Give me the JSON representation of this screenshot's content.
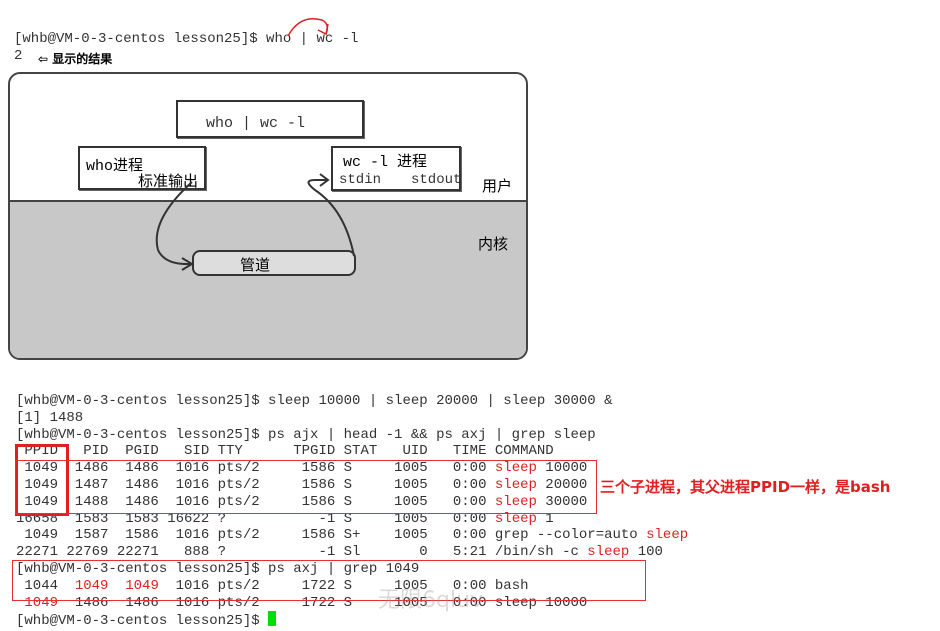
{
  "top_command": {
    "prompt": "[whb@VM-0-3-centos lesson25]$ ",
    "command": "who | wc -l",
    "output": "2",
    "annotation": "显示的结果",
    "arrow_icon": "left-arrow-icon"
  },
  "diagram": {
    "command_box": "who | wc -l",
    "who_process": "who进程",
    "stdout_label": "标准输出",
    "wc_process": "wc -l 进程",
    "stdin": "stdin",
    "stdout": "stdout",
    "user_label": "用户",
    "kernel_label": "内核",
    "pipe_label": "管道",
    "colors": {
      "kernel": "#c8c8c8",
      "arrow": "#e02020"
    }
  },
  "terminal": {
    "lines": [
      [
        {
          "t": "[whb@VM-0-3-centos lesson25]$ sleep 10000 | sleep 20000 | sleep 30000 &"
        }
      ],
      [
        {
          "t": "[1] 1488"
        }
      ],
      [
        {
          "t": "[whb@VM-0-3-centos lesson25]$ ps ajx | head -1 && ps axj | grep sleep"
        }
      ],
      [
        {
          "t": " PPID   PID  PGID   SID TTY      TPGID STAT   UID   TIME COMMAND"
        }
      ],
      [
        {
          "t": " 1049  1486  1486  1016 pts/2     1586 S     1005   0:00 "
        },
        {
          "t": "sleep",
          "r": true
        },
        {
          "t": " 10000"
        }
      ],
      [
        {
          "t": " 1049  1487  1486  1016 pts/2     1586 S     1005   0:00 "
        },
        {
          "t": "sleep",
          "r": true
        },
        {
          "t": " 20000"
        }
      ],
      [
        {
          "t": " 1049  1488  1486  1016 pts/2     1586 S     1005   0:00 "
        },
        {
          "t": "sleep",
          "r": true
        },
        {
          "t": " 30000"
        }
      ],
      [
        {
          "t": "16658  1583  1583 16622 ?           -1 S     1005   0:00 "
        },
        {
          "t": "sleep",
          "r": true
        },
        {
          "t": " 1"
        }
      ],
      [
        {
          "t": " 1049  1587  1586  1016 pts/2     1586 S+    1005   0:00 grep --color=auto "
        },
        {
          "t": "sleep",
          "r": true
        }
      ],
      [
        {
          "t": "22271 22769 22271   888 ?           -1 Sl       0   5:21 /bin/sh -c "
        },
        {
          "t": "sleep",
          "r": true
        },
        {
          "t": " 100"
        }
      ],
      [
        {
          "t": "[whb@VM-0-3-centos lesson25]$ ps axj | grep 1049"
        }
      ],
      [
        {
          "t": " 1044  "
        },
        {
          "t": "1049",
          "r": true
        },
        {
          "t": "  "
        },
        {
          "t": "1049",
          "r": true
        },
        {
          "t": "  1016 pts/2     1722 S     1005   0:00 bash"
        }
      ],
      [
        {
          "t": " "
        },
        {
          "t": "1049",
          "r": true
        },
        {
          "t": "  1486  1486  1016 pts/2     1722 S     1005   0:00 sleep 10000"
        }
      ],
      [
        {
          "t": "[whb@VM-0-3-centos lesson25]$ "
        }
      ]
    ],
    "annotation": "三个子进程，其父进程PPID一样，是bash",
    "watermark": "无限6qluv"
  }
}
